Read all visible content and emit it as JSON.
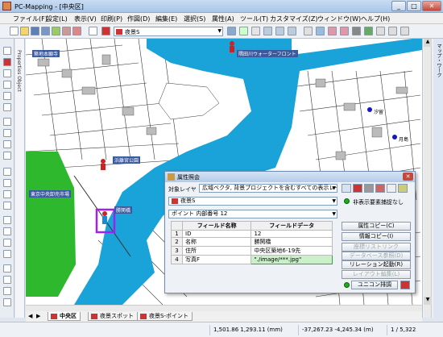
{
  "window": {
    "title": "PC-Mapping - [中央区]"
  },
  "menu": [
    "ファイル(F)",
    "設定(L)",
    "表示(V)",
    "印刷(P)",
    "作図(D)",
    "編集(E)",
    "選択(S)",
    "属性(A)",
    "ツール(T)",
    "カスタマイズ(Z)",
    "ウィンドウ(W)",
    "ヘルプ(H)"
  ],
  "toolbar": {
    "layer_select": "夜景S"
  },
  "left_panel_tab": "Properties Object",
  "right_panel_tab": "マップ・ワーク",
  "map": {
    "labels": {
      "shintomi": "築地本願寺",
      "sumida": "隅田川ウォーターフロント",
      "hamarikyu": "浜離宮公園",
      "market": "東京中央卸売市場",
      "kachidoki": "勝鬨橋",
      "station1": "汐留",
      "station2": "月島"
    }
  },
  "tabs": [
    "中央区",
    "夜景スポット",
    "夜景S-ポイント"
  ],
  "status": {
    "coords": "1,501.86 1,293.11 (mm)",
    "geo": "-37,267.23 -4,245.34 (m)",
    "page": "1 / 5,322"
  },
  "dialog": {
    "title": "属性照会",
    "target_label": "対象レイヤ",
    "target_value": "広域ベクタ, 背景プロジェクトを含むすべての表示レイヤ",
    "layer_value": "夜景S",
    "hidden_label": "非表示要素捕捉なし",
    "point_value": "ポイント 内部番号 12",
    "columns": [
      "フィールド名称",
      "フィールドデータ"
    ],
    "rows": [
      {
        "n": "1",
        "name": "ID",
        "value": "12"
      },
      {
        "n": "2",
        "name": "名称",
        "value": "勝鬨橋"
      },
      {
        "n": "3",
        "name": "住所",
        "value": "中央区築地6-19先"
      },
      {
        "n": "4",
        "name": "写真F",
        "value": "\"./image/***.jpg\""
      }
    ],
    "buttons": {
      "attr_copy": "属性コピー(C)",
      "info_copy": "情報コピー(I)",
      "link": "座標リストリンク",
      "db": "データベース参照(D)",
      "relation": "リレーション起動(R)",
      "layout": "レイアウト編集(L)",
      "unicorn": "ユニコン排調"
    }
  }
}
